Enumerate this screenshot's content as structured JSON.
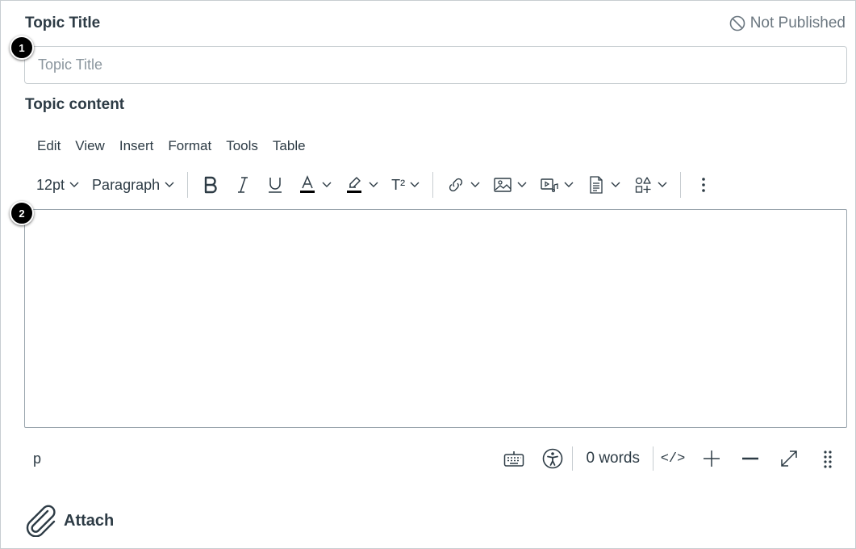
{
  "header": {
    "title_label": "Topic Title",
    "publish_status": "Not Published"
  },
  "title_input": {
    "placeholder": "Topic Title",
    "value": ""
  },
  "callouts": [
    "1",
    "2"
  ],
  "content_label": "Topic content",
  "menubar": [
    "Edit",
    "View",
    "Insert",
    "Format",
    "Tools",
    "Table"
  ],
  "toolbar": {
    "font_size": "12pt",
    "block_format": "Paragraph",
    "superscript_label": "T²",
    "icons": [
      "bold-icon",
      "italic-icon",
      "underline-icon",
      "text-color-icon",
      "highlight-icon",
      "superscript-icon",
      "link-icon",
      "image-icon",
      "media-icon",
      "document-icon",
      "apps-icon",
      "more-options-icon"
    ]
  },
  "statusbar": {
    "path": "p",
    "word_count": "0 words",
    "html_toggle": "</>"
  },
  "attach": {
    "label": "Attach"
  },
  "colors": {
    "text": "#2d3b45",
    "muted": "#6b7780",
    "border": "#c7cdd1"
  }
}
